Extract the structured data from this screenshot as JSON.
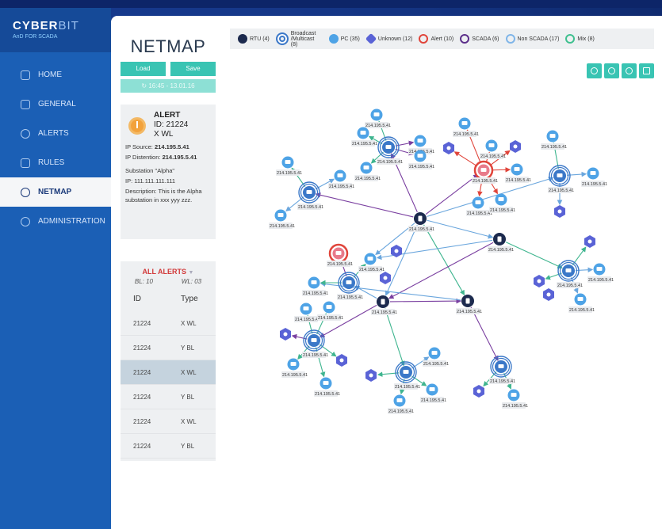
{
  "brand": {
    "name_a": "CYBER",
    "name_b": "BIT",
    "sub": "AnD FOR SCADA"
  },
  "nav": [
    {
      "label": "HOME",
      "icon": "home-icon"
    },
    {
      "label": "GENERAL",
      "icon": "general-icon"
    },
    {
      "label": "ALERTS",
      "icon": "bell-icon"
    },
    {
      "label": "RULES",
      "icon": "rules-icon"
    },
    {
      "label": "NETMAP",
      "icon": "globe-icon",
      "active": true
    },
    {
      "label": "ADMINISTRATION",
      "icon": "gear-icon"
    }
  ],
  "page": {
    "title": "NETMAP",
    "load": "Load",
    "save": "Save",
    "timestamp": "16:45 - 13.01.16"
  },
  "alert": {
    "heading": "ALERT",
    "id": "ID: 21224",
    "type": "X WL",
    "ip_source_label": "IP Source:",
    "ip_source": "214.195.5.41",
    "ip_dest_label": "IP Distention:",
    "ip_dest": "214.195.5.41",
    "substation": "Substation \"Alpha\"",
    "ip": "IP: 111.111.111.111",
    "description": "Description: This is the Alpha substation in xxx yyy zzz."
  },
  "alerts_table": {
    "title": "ALL ALERTS",
    "bl": "BL: 10",
    "wl": "WL: 03",
    "col_id": "ID",
    "col_type": "Type",
    "rows": [
      {
        "id": "21224",
        "type": "X WL"
      },
      {
        "id": "21224",
        "type": "Y BL"
      },
      {
        "id": "21224",
        "type": "X WL"
      },
      {
        "id": "21224",
        "type": "Y BL"
      },
      {
        "id": "21224",
        "type": "X WL"
      },
      {
        "id": "21224",
        "type": "Y BL"
      }
    ]
  },
  "legend": [
    {
      "label": "RTU (4)",
      "color": "#1c2a4e"
    },
    {
      "label": "Broadcast /Multicast (8)",
      "color": "#3b78c8"
    },
    {
      "label": "PC (35)",
      "color": "#4ea3e6"
    },
    {
      "label": "Unknown (12)",
      "color": "#5a63d6"
    },
    {
      "label": "Alert (10)",
      "color": "#e0443a"
    },
    {
      "label": "SCADA (6)",
      "color": "#5c2f8a"
    },
    {
      "label": "Non SCADA (17)",
      "color": "#7fb5e8"
    },
    {
      "label": "Mix (8)",
      "color": "#3fc08f"
    }
  ],
  "node_label": "214.195.5.41",
  "colors": {
    "teal": "#39c4b3",
    "sidebar": "#1b5fb5",
    "active_marker": "#f6c232"
  }
}
